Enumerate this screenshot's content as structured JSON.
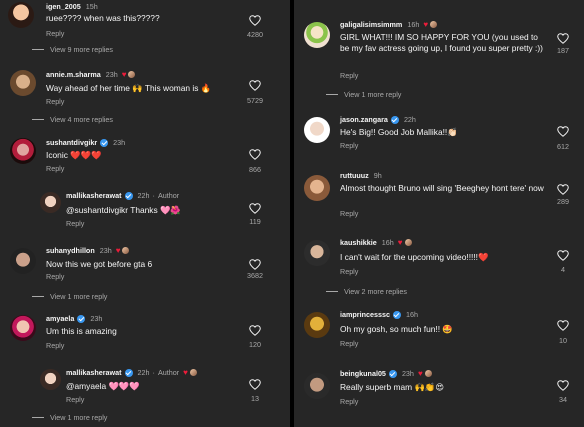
{
  "left_comments": [
    {
      "username": "igen_2005",
      "time": "15h",
      "text": "ruee???? when was this?????",
      "reply_label": "Reply",
      "likes": "4280",
      "verified": false,
      "view_more": "View 9 more replies"
    },
    {
      "username": "annie.m.sharma",
      "time": "23h",
      "text": "Way ahead of her time 🙌 This woman is 🔥",
      "reply_label": "Reply",
      "likes": "5729",
      "verified": false,
      "view_more": "View 4 more replies"
    },
    {
      "username": "sushantdivgikr",
      "time": "23h",
      "text": "Iconic ❤️❤️❤️",
      "reply_label": "Reply",
      "likes": "866",
      "verified": true
    },
    {
      "username": "mallikasherawat",
      "time": "22h",
      "author": "Author",
      "text": "@sushantdivgikr Thanks 🩷🌺",
      "reply_label": "Reply",
      "likes": "119",
      "verified": true
    },
    {
      "username": "suhanydhillon",
      "time": "23h",
      "text": "Now this we got before gta 6",
      "reply_label": "Reply",
      "likes": "3682",
      "verified": false,
      "view_more": "View 1 more reply"
    },
    {
      "username": "amyaela",
      "time": "23h",
      "text": "Um this is amazing",
      "reply_label": "Reply",
      "likes": "120",
      "verified": true
    },
    {
      "username": "mallikasherawat",
      "time": "22h",
      "author": "Author",
      "text": "@amyaela 🩷🩷🩷",
      "reply_label": "Reply",
      "likes": "13",
      "verified": true,
      "view_more": "View 1 more reply"
    }
  ],
  "right_comments": [
    {
      "username": "galigalisimsimmm",
      "time": "16h",
      "text": "GIRL WHAT!!! IM SO HAPPY FOR YOU (you used to be my fav actress going up, I found you super pretty :))",
      "reply_label": "Reply",
      "likes": "187",
      "verified": false,
      "view_more": "View 1 more reply"
    },
    {
      "username": "jason.zangara",
      "time": "22h",
      "text": "He's Big!! Good Job Mallika!!👏🏻",
      "reply_label": "Reply",
      "likes": "612",
      "verified": true
    },
    {
      "username": "ruttuuuz",
      "time": "9h",
      "text": "Almost thought Bruno will sing 'Beeghey hont tere' now",
      "reply_label": "Reply",
      "likes": "289",
      "verified": false
    },
    {
      "username": "kaushikkie",
      "time": "16h",
      "text": "I can't wait for the upcoming video!!!!!❤️",
      "reply_label": "Reply",
      "likes": "4",
      "verified": false,
      "view_more": "View 2 more replies"
    },
    {
      "username": "iamprincesssc",
      "time": "16h",
      "text": "Oh my gosh, so much fun!! 🤩",
      "reply_label": "Reply",
      "likes": "10",
      "verified": true
    },
    {
      "username": "beingkunal05",
      "time": "23h",
      "text": "Really superb mam 🙌👏😍",
      "reply_label": "Reply",
      "likes": "34",
      "verified": true
    }
  ],
  "icons": {
    "like": "heart-outline-icon",
    "liked_by_author": "heart-filled-icon",
    "verified": "verified-badge-icon"
  },
  "colors": {
    "background": "#262626",
    "text": "#f5f5f5",
    "muted": "#a8a8a8",
    "verified": "#3897f0",
    "liked": "#ed1c3a"
  }
}
